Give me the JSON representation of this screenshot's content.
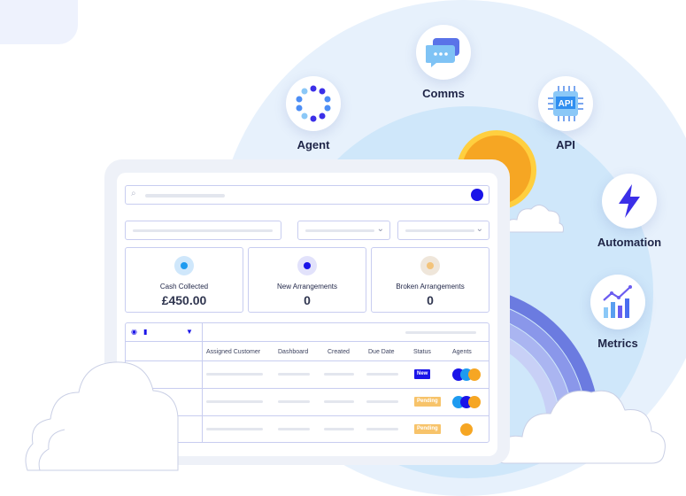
{
  "features": [
    {
      "label": "Agent",
      "icon": "agent-dots-icon"
    },
    {
      "label": "Comms",
      "icon": "chat-bubble-icon"
    },
    {
      "label": "API",
      "icon": "api-chip-icon"
    },
    {
      "label": "Automation",
      "icon": "lightning-bolt-icon"
    },
    {
      "label": "Metrics",
      "icon": "bar-chart-icon"
    }
  ],
  "api_chip_text": "API",
  "stats": [
    {
      "title": "Cash Collected",
      "value": "£450.00",
      "color": "#1e9bf0"
    },
    {
      "title": "New Arrangements",
      "value": "0",
      "color": "#1a14e8"
    },
    {
      "title": "Broken Arrangements",
      "value": "0",
      "color": "#f3c37a"
    }
  ],
  "table": {
    "columns": [
      "Assigned Customer",
      "Dashboard",
      "Created",
      "Due Date",
      "Status",
      "Agents"
    ],
    "rows": [
      {
        "status": "New",
        "status_color": "#1a14e8",
        "agents": [
          "#1a14e8",
          "#1e9bf0",
          "#f6a623"
        ]
      },
      {
        "status": "Pending",
        "status_color": "#f7c36a",
        "agents": [
          "#1e9bf0",
          "#1a14e8",
          "#f6a623"
        ]
      },
      {
        "status": "Pending",
        "status_color": "#f7c36a",
        "agents": [
          "#f6a623"
        ]
      }
    ]
  },
  "colors": {
    "accent": "#1a14e8",
    "sun": "#f6a623"
  }
}
